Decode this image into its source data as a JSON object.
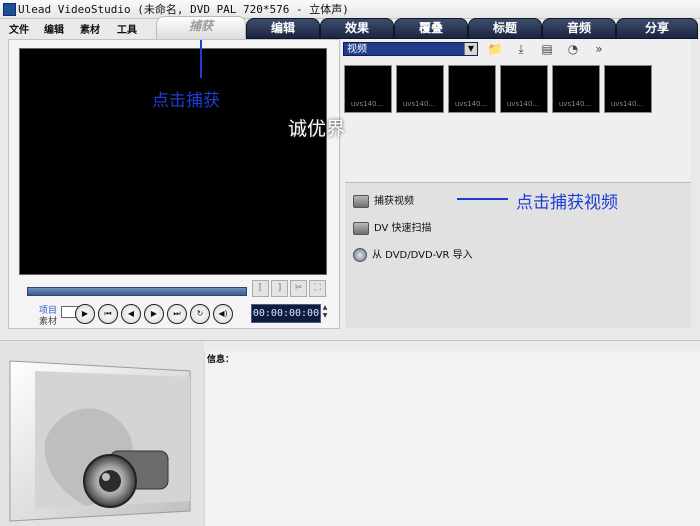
{
  "window": {
    "title": "Ulead VideoStudio (未命名, DVD PAL 720*576 - 立体声)"
  },
  "menu": [
    "文件",
    "编辑",
    "素材",
    "工具"
  ],
  "tabs": [
    {
      "label": "捕获",
      "active": true
    },
    {
      "label": "编辑"
    },
    {
      "label": "效果"
    },
    {
      "label": "覆叠"
    },
    {
      "label": "标题"
    },
    {
      "label": "音频"
    },
    {
      "label": "分享"
    }
  ],
  "player": {
    "mode_project": "项目",
    "mode_clip": "素材",
    "trim_start": "[",
    "trim_end": "]",
    "timecode": "00:00:00:00",
    "buttons": [
      "play",
      "home",
      "previous",
      "next",
      "end",
      "repeat",
      "volume"
    ]
  },
  "library": {
    "category": "视频",
    "thumbnails": [
      "uvs140...",
      "uvs140...",
      "uvs140...",
      "uvs140...",
      "uvs140...",
      "uvs140..."
    ],
    "tools": [
      "folder-icon",
      "import-icon",
      "options-icon",
      "sort-icon",
      "expand-icon"
    ]
  },
  "capture_options": [
    {
      "label": "捕获视频",
      "icon": "camera-icon"
    },
    {
      "label": "DV 快速扫描",
      "icon": "dv-scan-icon"
    },
    {
      "label": "从 DVD/DVD-VR 导入",
      "icon": "disc-icon"
    }
  ],
  "info": {
    "label": "信息："
  },
  "annotations": {
    "click_capture": "点击捕获",
    "click_capture_video": "点击捕获视频",
    "watermark": "诚优界",
    "color": "#1d3ed6"
  },
  "colors": {
    "tab_bg": "#1b2540",
    "preview_bg": "#000000",
    "timecode_bg": "#0e1c3d"
  }
}
